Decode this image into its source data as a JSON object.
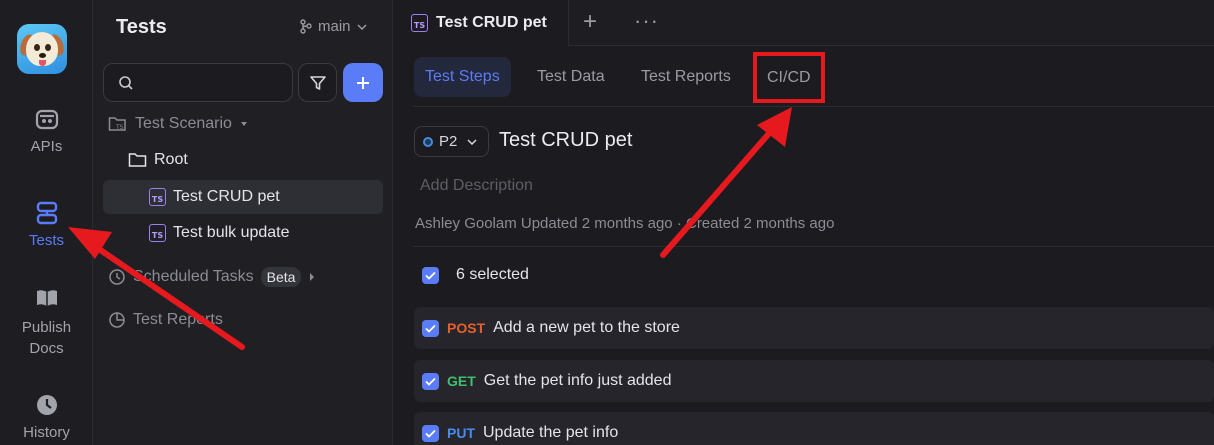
{
  "rail": {
    "items": [
      {
        "label": "APIs"
      },
      {
        "label": "Tests"
      },
      {
        "label": "Publish Docs"
      },
      {
        "label": "History"
      }
    ]
  },
  "sidebar": {
    "title": "Tests",
    "branch": "main",
    "tree": {
      "scenario": "Test Scenario",
      "root": "Root",
      "item1": "Test CRUD pet",
      "item2": "Test bulk update",
      "scheduled": "Scheduled Tasks",
      "beta": "Beta",
      "reports": "Test Reports"
    }
  },
  "tabs": {
    "active_doc": "Test CRUD pet"
  },
  "subtabs": [
    "Test Steps",
    "Test Data",
    "Test Reports",
    "CI/CD"
  ],
  "case": {
    "priority": "P2",
    "title": "Test CRUD pet",
    "description_placeholder": "Add Description",
    "meta": "Ashley Goolam Updated 2 months ago · Created 2 months ago",
    "selected": "6 selected"
  },
  "steps": [
    {
      "method": "POST",
      "color": "#e8612c",
      "label": "Add a new pet to the store"
    },
    {
      "method": "GET",
      "color": "#3fbf6f",
      "label": "Get the pet info just added"
    },
    {
      "method": "PUT",
      "color": "#4a8bf0",
      "label": "Update the pet info"
    }
  ],
  "colors": {
    "accent": "#5b7cf7",
    "highlight": "#e5191e"
  }
}
